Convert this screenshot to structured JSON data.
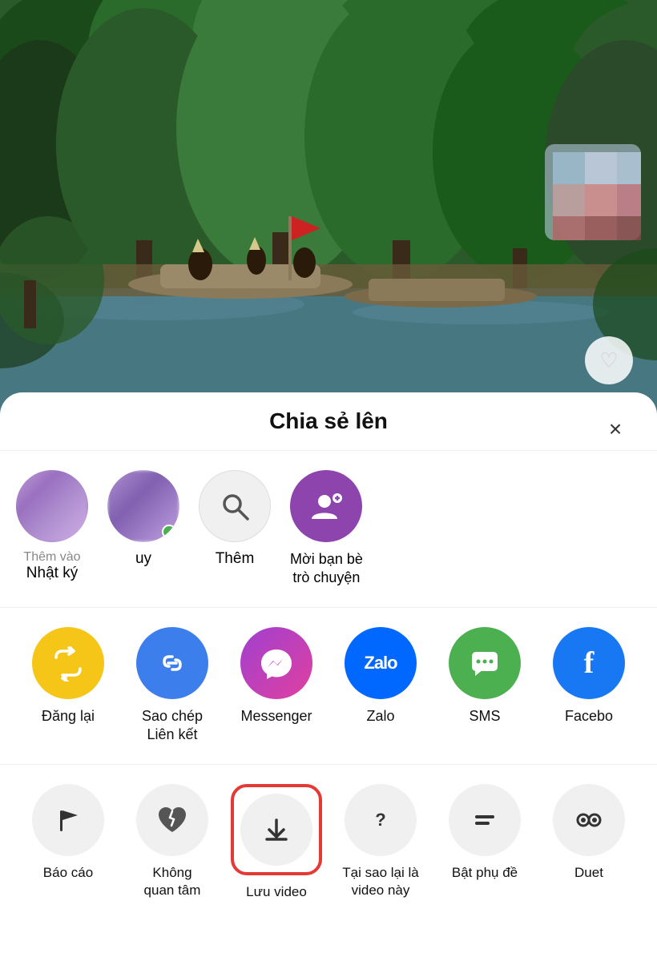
{
  "video": {
    "alt": "River scene with boats and trees"
  },
  "sheet": {
    "title": "Chia sẻ lên",
    "close_label": "×"
  },
  "friends": [
    {
      "id": "friend-1",
      "label": "Nhật ký",
      "sublabel": "Thêm vào",
      "type": "blurred-purple-1"
    },
    {
      "id": "friend-2",
      "label": "uy",
      "type": "blurred-purple-2",
      "has_online": true
    },
    {
      "id": "friend-more",
      "label": "Thêm",
      "type": "search"
    },
    {
      "id": "friend-invite",
      "label": "Mời bạn bè\ntrò chuyện",
      "type": "invite"
    }
  ],
  "actions": [
    {
      "id": "repost",
      "icon": "↺↻",
      "icon_unicode": "⟳",
      "label": "Đăng lại",
      "bg": "yellow"
    },
    {
      "id": "copy-link",
      "icon": "🔗",
      "label": "Sao chép\nLiên kết",
      "bg": "blue"
    },
    {
      "id": "messenger",
      "icon": "ⓜ",
      "label": "Messenger",
      "bg": "messenger"
    },
    {
      "id": "zalo",
      "icon": "Zalo",
      "label": "Zalo",
      "bg": "zalo"
    },
    {
      "id": "sms",
      "icon": "💬",
      "label": "SMS",
      "bg": "green"
    },
    {
      "id": "facebook",
      "icon": "f",
      "label": "Facebo...",
      "bg": "facebook"
    }
  ],
  "bottom_actions": [
    {
      "id": "report",
      "icon": "⚑",
      "label": "Báo cáo",
      "highlighted": false
    },
    {
      "id": "not-interested",
      "icon": "💔",
      "label": "Không\nquan tâm",
      "highlighted": false
    },
    {
      "id": "save-video",
      "icon": "⬇",
      "label": "Lưu video",
      "highlighted": true
    },
    {
      "id": "why",
      "icon": "?",
      "label": "Tại sao lại là\nvideo này",
      "highlighted": false
    },
    {
      "id": "subtitles",
      "icon": "≡",
      "label": "Bật phụ đề",
      "highlighted": false
    },
    {
      "id": "duet",
      "icon": "((●))",
      "label": "Duet",
      "highlighted": false
    }
  ]
}
